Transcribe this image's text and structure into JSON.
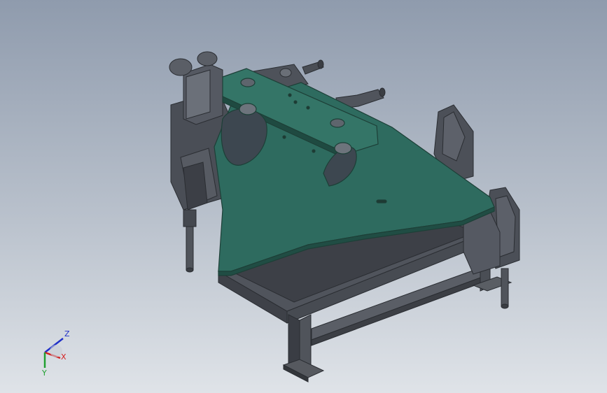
{
  "viewport": {
    "background_top": "#8f9bad",
    "background_bottom": "#dfe3e8"
  },
  "model": {
    "plate_color": "#2e6b5f",
    "frame_color": "#4b4f57"
  },
  "triad": {
    "x_label": "X",
    "y_label": "Y",
    "z_label": "Z",
    "x_color": "#d42020",
    "y_color": "#20a030",
    "z_color": "#2030c8"
  }
}
